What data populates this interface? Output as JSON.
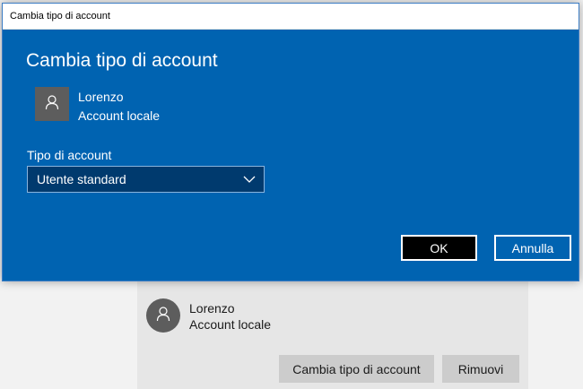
{
  "window": {
    "title": "Cambia tipo di account"
  },
  "dialog": {
    "heading": "Cambia tipo di account",
    "user": {
      "name": "Lorenzo",
      "account_type": "Account locale",
      "avatar_icon": "person-icon"
    },
    "account_type_label": "Tipo di account",
    "account_type_select": {
      "value": "Utente standard",
      "icon": "chevron-down-icon"
    },
    "ok_label": "OK",
    "cancel_label": "Annulla"
  },
  "background": {
    "user": {
      "name": "Lorenzo",
      "account_type": "Account locale",
      "avatar_icon": "person-icon"
    },
    "change_type_label": "Cambia tipo di account",
    "remove_label": "Rimuovi"
  },
  "colors": {
    "dialog_background": "#0063b1",
    "select_background": "#003a6e",
    "ok_button_background": "#000000",
    "avatar_background": "#5d5d5d",
    "page_background": "#f2f2f2",
    "panel_background": "#e6e6e6",
    "panel_button_background": "#cccccc"
  }
}
